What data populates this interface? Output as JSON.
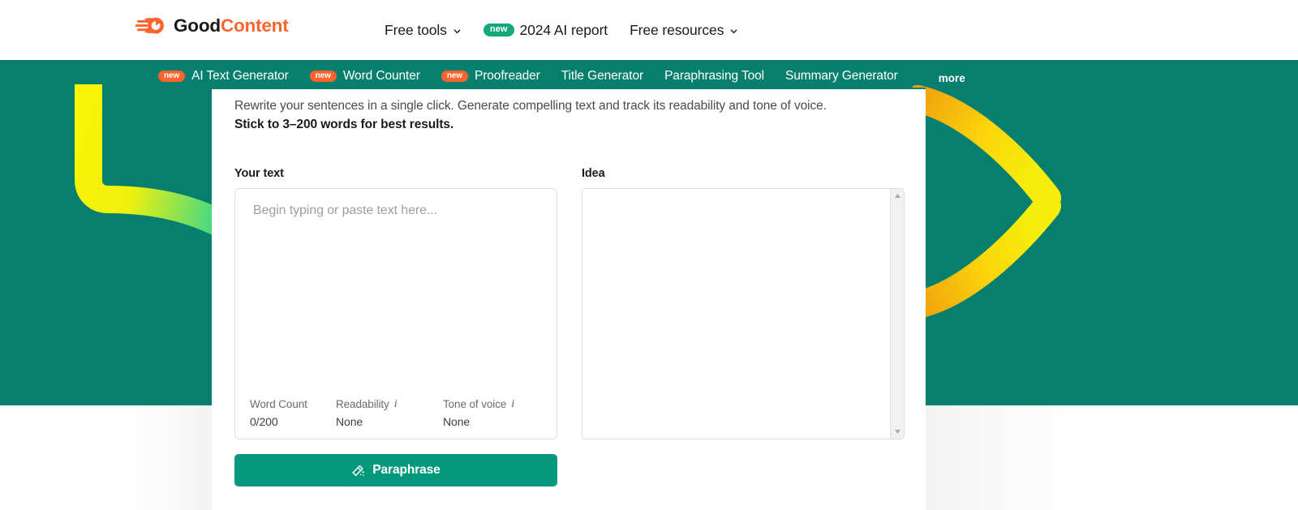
{
  "brand": {
    "logo_icon": "comet-logo-icon",
    "name_part1": "Good",
    "name_part2": "Content",
    "accent_color": "#ff642d"
  },
  "top_nav": {
    "items": [
      {
        "label": "Free tools",
        "has_caret": true,
        "badge": null
      },
      {
        "label": "2024 AI report",
        "has_caret": false,
        "badge": "new"
      },
      {
        "label": "Free resources",
        "has_caret": true,
        "badge": null
      }
    ]
  },
  "tools_nav": {
    "background_color": "#067f6f",
    "items": [
      {
        "label": "AI Text Generator",
        "badge": "new"
      },
      {
        "label": "Word Counter",
        "badge": "new"
      },
      {
        "label": "Proofreader",
        "badge": "new"
      },
      {
        "label": "Title Generator",
        "badge": null
      },
      {
        "label": "Paraphrasing Tool",
        "badge": null
      },
      {
        "label": "Summary Generator",
        "badge": null
      }
    ],
    "more_label": "more"
  },
  "card": {
    "description_line1": "Rewrite your sentences in a single click. Generate compelling text and track its readability and tone of voice.",
    "description_line2": "Stick to 3–200 words for best results.",
    "your_text_label": "Your text",
    "idea_label": "Idea",
    "editor": {
      "placeholder": "Begin typing or paste text here...",
      "value": ""
    },
    "idea_editor": {
      "value": "",
      "scrollbar_up_icon": "scroll-up-arrow-icon",
      "scrollbar_down_icon": "scroll-down-arrow-icon"
    },
    "stats": [
      {
        "label": "Word Count",
        "value": "0/200",
        "has_info": false
      },
      {
        "label": "Readability",
        "value": "None",
        "has_info": true
      },
      {
        "label": "Tone of voice",
        "value": "None",
        "has_info": true
      }
    ],
    "submit": {
      "label": "Paraphrase",
      "icon": "magic-wand-icon",
      "color": "#04997f"
    }
  },
  "decor": {
    "left_shape": "yellow-green-elbow-curve",
    "right_shape": "yellow-chevron-curve"
  }
}
